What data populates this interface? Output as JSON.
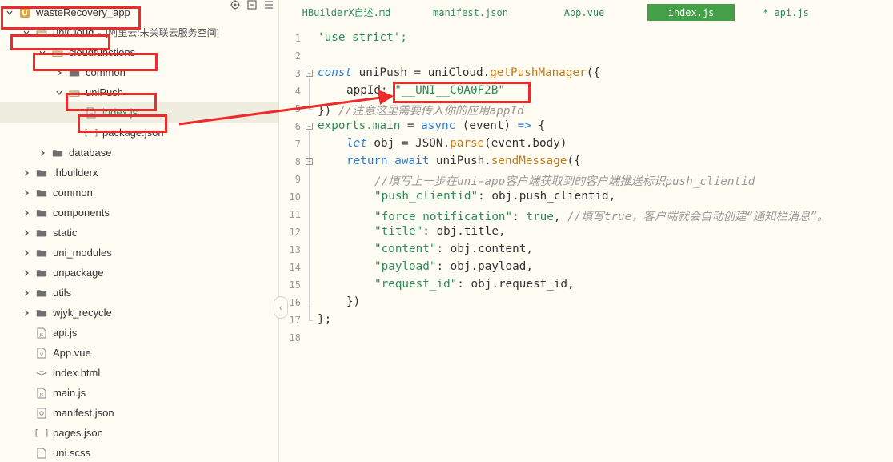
{
  "tree": {
    "toolbar": [
      {
        "icon": "target-icon"
      },
      {
        "icon": "minimize-icon"
      },
      {
        "icon": "menu-icon"
      }
    ],
    "items": [
      {
        "label": "wasteRecovery_app",
        "icon": "project-icon",
        "expanded": true,
        "depth": 0
      },
      {
        "label": "uniCloud",
        "tag_prefix": " - ",
        "tag": "[阿里云:未关联云服务空间]",
        "icon": "folder-open-icon",
        "expanded": true,
        "depth": 1
      },
      {
        "label": "cloudfunctions",
        "icon": "folder-open-icon",
        "expanded": true,
        "depth": 2
      },
      {
        "label": "common",
        "icon": "folder-icon",
        "expanded": false,
        "depth": 3
      },
      {
        "label": "uniPush",
        "icon": "folder-open-icon",
        "expanded": true,
        "depth": 3
      },
      {
        "label": "index.js",
        "icon": "file-js-icon",
        "depth": 4,
        "selected": true
      },
      {
        "label": "package.json",
        "icon": "file-json-icon",
        "depth": 4
      },
      {
        "label": "database",
        "icon": "folder-icon",
        "expanded": false,
        "depth": 2
      },
      {
        "label": ".hbuilderx",
        "icon": "folder-icon",
        "expanded": false,
        "depth": 1
      },
      {
        "label": "common",
        "icon": "folder-icon",
        "expanded": false,
        "depth": 1
      },
      {
        "label": "components",
        "icon": "folder-icon",
        "expanded": false,
        "depth": 1
      },
      {
        "label": "static",
        "icon": "folder-icon",
        "expanded": false,
        "depth": 1
      },
      {
        "label": "uni_modules",
        "icon": "folder-icon",
        "expanded": false,
        "depth": 1
      },
      {
        "label": "unpackage",
        "icon": "folder-icon",
        "expanded": false,
        "depth": 1
      },
      {
        "label": "utils",
        "icon": "folder-icon",
        "expanded": false,
        "depth": 1
      },
      {
        "label": "wjyk_recycle",
        "icon": "folder-icon",
        "expanded": false,
        "depth": 1
      },
      {
        "label": "api.js",
        "icon": "file-js-icon",
        "depth": 1
      },
      {
        "label": "App.vue",
        "icon": "file-vue-icon",
        "depth": 1
      },
      {
        "label": "index.html",
        "icon": "file-html-icon",
        "depth": 1
      },
      {
        "label": "main.js",
        "icon": "file-js-icon",
        "depth": 1
      },
      {
        "label": "manifest.json",
        "icon": "file-manifest-icon",
        "depth": 1
      },
      {
        "label": "pages.json",
        "icon": "file-json-icon",
        "depth": 1
      },
      {
        "label": "uni.scss",
        "icon": "file-css-icon",
        "depth": 1
      }
    ]
  },
  "tabs": [
    {
      "label": "HBuilderX自述.md",
      "active": false
    },
    {
      "label": "manifest.json",
      "active": false
    },
    {
      "label": "App.vue",
      "active": false
    },
    {
      "label": "index.js",
      "active": true
    },
    {
      "label": "* api.js",
      "active": false
    }
  ],
  "code": {
    "lines": [
      {
        "n": "1"
      },
      {
        "n": "2"
      },
      {
        "n": "3"
      },
      {
        "n": "4"
      },
      {
        "n": "5"
      },
      {
        "n": "6"
      },
      {
        "n": "7"
      },
      {
        "n": "8"
      },
      {
        "n": "9"
      },
      {
        "n": "10"
      },
      {
        "n": "11"
      },
      {
        "n": "12"
      },
      {
        "n": "13"
      },
      {
        "n": "14"
      },
      {
        "n": "15"
      },
      {
        "n": "16"
      },
      {
        "n": "17"
      },
      {
        "n": "18"
      }
    ],
    "t": {
      "l1": "'use strict';",
      "l3a": "const",
      "l3b": " uniPush = uniCloud.",
      "l3c": "getPushManager",
      "l3d": "({",
      "l4a": "appId: ",
      "l4b": "\"__UNI__C0A0F2B\"",
      "l5a": "}) ",
      "l5b": "//注意这里需要传入你的应用appId",
      "l6a": "exports.",
      "l6b": "main",
      "l6c": " = ",
      "l6d": "async",
      "l6e": " (event) ",
      "l6f": "=>",
      "l6g": " {",
      "l7a": "let",
      "l7b": " obj = JSON.",
      "l7c": "parse",
      "l7d": "(event.body)",
      "l8a": "return",
      "l8b": " ",
      "l8c": "await",
      "l8d": " uniPush.",
      "l8e": "sendMessage",
      "l8f": "({",
      "l9": "//填写上一步在uni-app客户端获取到的客户端推送标识push_clientid",
      "l10a": "\"push_clientid\"",
      "l10b": ": obj.push_clientid,",
      "l11a": "\"force_notification\"",
      "l11b": ": ",
      "l11c": "true",
      "l11d": ", ",
      "l11e": "//填写true，客户端就会自动创建“通知栏消息”。",
      "l12a": "\"title\"",
      "l12b": ": obj.title,",
      "l13a": "\"content\"",
      "l13b": ": obj.content,",
      "l14a": "\"payload\"",
      "l14b": ": obj.payload,",
      "l15a": "\"request_id\"",
      "l15b": ": obj.request_id,",
      "l16": "})",
      "l17": "};"
    }
  },
  "colors": {
    "background": "#fffdf3",
    "active_tab": "#43a047",
    "keyword": "#2b7cd3",
    "string": "#2e8b57",
    "function": "#c07a1a",
    "comment": "#9a9a9a",
    "annotation": "#ee2b2b"
  }
}
